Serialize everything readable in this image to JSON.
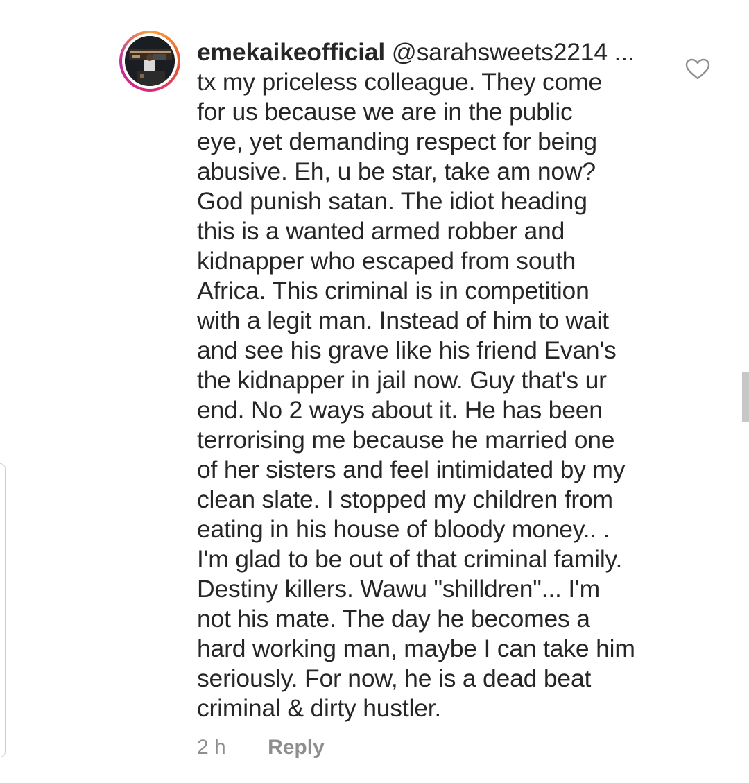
{
  "comment": {
    "username": "emekaikeofficial",
    "mention": "@sarahsweets2214",
    "mention_suffix": " ...",
    "body_lines": [
      "tx my priceless colleague.  They come",
      "for us because we are in the public",
      "eye, yet demanding respect for being",
      "abusive.  Eh, u be star, take am now?",
      "God punish satan. The idiot heading",
      "this is a wanted armed robber and",
      "kidnapper who escaped from south",
      "Africa.  This criminal is in competition",
      "with a legit man. Instead of him to wait",
      "and see his grave like his friend Evan's",
      "the kidnapper in jail now. Guy that's ur",
      "end. No 2 ways about it.  He has been",
      "terrorising me because he married one",
      "of her sisters and feel intimidated by my",
      "clean slate. I stopped my children from",
      "eating in his house of bloody money.. .",
      "I'm glad to be out of that criminal family.",
      "Destiny killers. Wawu \"shilldren\"... I'm",
      "not his mate. The day he becomes a",
      "hard working man, maybe I can take him",
      "seriously.  For now, he is a dead beat",
      "criminal & dirty hustler."
    ],
    "timestamp": "2 h",
    "reply_label": "Reply"
  },
  "icons": {
    "like": "heart-outline-icon",
    "avatar": "profile-avatar"
  },
  "colors": {
    "text": "#262626",
    "secondary": "#8e8e8e",
    "heart_stroke": "#8e8e8e"
  }
}
